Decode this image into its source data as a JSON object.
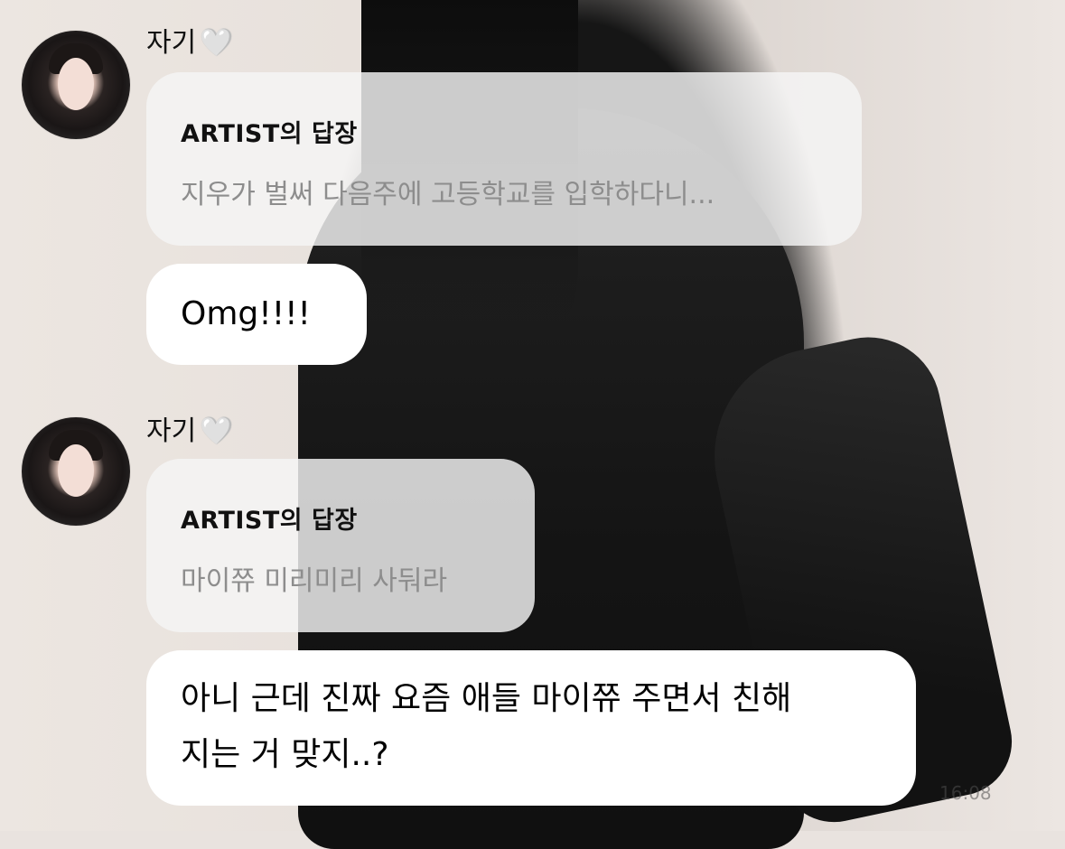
{
  "chat": {
    "groups": [
      {
        "sender": {
          "name": "자기",
          "emoji": "🤍"
        },
        "reply": {
          "title": "ARTIST의 답장",
          "text": "지우가 벌써 다음주에 고등학교를 입학하다니..."
        },
        "message": "Omg!!!!"
      },
      {
        "sender": {
          "name": "자기",
          "emoji": "🤍"
        },
        "reply": {
          "title": "ARTIST의 답장",
          "text": "마이쮸 미리미리 사둬라"
        },
        "message_lines": [
          "아니 근데 진짜 요즘 애들 마이쮸 주면서 친해",
          "지는 거 맞지..?"
        ]
      }
    ],
    "timestamp": "16:08"
  }
}
